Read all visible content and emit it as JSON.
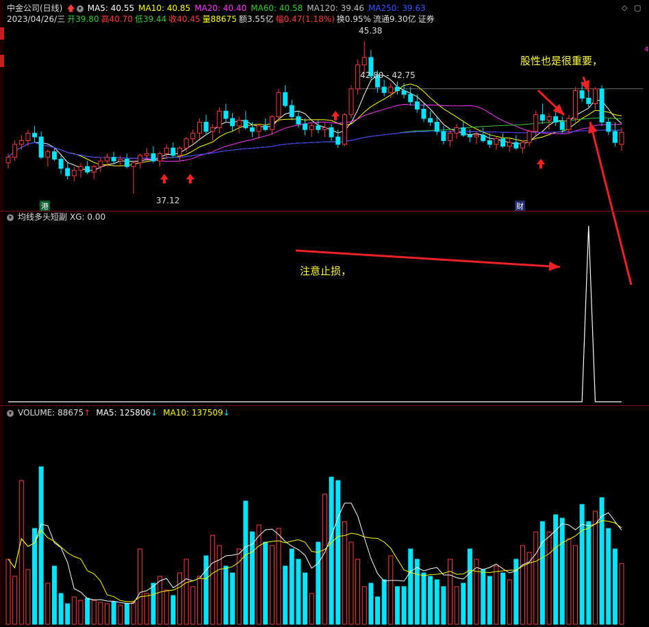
{
  "header": {
    "stock_name": "中金公司(日线)",
    "ma5": "MA5: 40.55",
    "ma10": "MA10: 40.85",
    "ma20": "MA20: 40.40",
    "ma60": "MA60: 40.58",
    "ma120": "MA120: 39.46",
    "ma250": "MA250: 39.63",
    "date": "2023/04/26/三",
    "open": "开39.80",
    "high": "高40.70",
    "low": "低39.44",
    "close": "收40.45",
    "volume": "量88675",
    "amount": "额3.55亿",
    "change": "幅0.47(1.18%)",
    "turnover": "换0.95%",
    "float_cap": "流通9.30亿",
    "sector": "证券"
  },
  "price_labels": {
    "high_mark": "45.38",
    "low_mark": "37.12",
    "range_mark": "42.80 - 42.75",
    "right_edge": "4"
  },
  "badges": {
    "left_badge": "港",
    "right_badge": "财"
  },
  "annotations": {
    "a1": "股性也是很重要，",
    "a2": "注意止损，"
  },
  "indicator_panel": {
    "title": "均线多头短副",
    "value": "XG: 0.00"
  },
  "volume_panel": {
    "volume": "VOLUME: 88675",
    "ma5": "MA5: 125806",
    "ma10": "MA10: 137509"
  },
  "colors": {
    "up": "#ff3c3c",
    "down": "#00e5ff",
    "ma5": "#ffffff",
    "ma10": "#ffff00",
    "ma20": "#ff33ff",
    "ma60": "#33cc33",
    "ma120": "#aaaaaa",
    "ma250": "#3333ff",
    "arrow": "#ee2222"
  },
  "chart_data": {
    "type": "candlestick",
    "price_axis_range": [
      36.5,
      46.2
    ],
    "candles": [
      [
        38.8,
        39.3,
        38.5,
        39.1
      ],
      [
        39.1,
        40.0,
        38.9,
        39.8
      ],
      [
        39.8,
        40.3,
        39.5,
        40.0
      ],
      [
        40.0,
        40.6,
        39.7,
        40.4
      ],
      [
        40.4,
        40.8,
        39.9,
        40.2
      ],
      [
        40.2,
        40.5,
        39.0,
        39.1
      ],
      [
        39.1,
        39.5,
        38.6,
        39.4
      ],
      [
        39.4,
        39.6,
        38.9,
        39.0
      ],
      [
        39.0,
        39.2,
        38.2,
        38.5
      ],
      [
        38.5,
        38.8,
        37.9,
        38.1
      ],
      [
        38.1,
        38.6,
        37.8,
        38.4
      ],
      [
        38.4,
        38.8,
        38.0,
        38.6
      ],
      [
        38.6,
        38.9,
        38.2,
        38.3
      ],
      [
        38.3,
        38.7,
        37.9,
        38.6
      ],
      [
        38.6,
        39.1,
        38.3,
        38.9
      ],
      [
        38.9,
        39.3,
        38.6,
        39.1
      ],
      [
        39.1,
        39.4,
        38.7,
        38.9
      ],
      [
        38.9,
        39.2,
        38.6,
        39.0
      ],
      [
        39.0,
        39.3,
        38.5,
        38.6
      ],
      [
        38.6,
        38.9,
        37.12,
        38.8
      ],
      [
        38.8,
        39.3,
        38.5,
        39.2
      ],
      [
        39.2,
        39.6,
        38.9,
        39.3
      ],
      [
        39.3,
        39.7,
        38.8,
        38.9
      ],
      [
        38.9,
        39.4,
        38.6,
        39.3
      ],
      [
        39.3,
        39.8,
        39.0,
        39.6
      ],
      [
        39.6,
        39.9,
        39.1,
        39.2
      ],
      [
        39.2,
        39.7,
        38.9,
        39.6
      ],
      [
        39.6,
        40.2,
        39.4,
        40.1
      ],
      [
        40.1,
        40.6,
        39.8,
        40.4
      ],
      [
        40.4,
        41.2,
        40.1,
        41.0
      ],
      [
        41.0,
        41.4,
        40.3,
        40.5
      ],
      [
        40.5,
        40.9,
        40.0,
        40.7
      ],
      [
        40.7,
        41.8,
        40.4,
        41.6
      ],
      [
        41.6,
        42.0,
        41.0,
        41.2
      ],
      [
        41.2,
        41.5,
        40.5,
        40.8
      ],
      [
        40.8,
        41.3,
        40.4,
        41.1
      ],
      [
        41.1,
        41.6,
        40.6,
        40.7
      ],
      [
        40.7,
        41.0,
        40.2,
        40.5
      ],
      [
        40.5,
        40.9,
        40.1,
        40.8
      ],
      [
        40.8,
        41.2,
        40.5,
        40.6
      ],
      [
        40.6,
        41.4,
        40.3,
        41.3
      ],
      [
        41.3,
        42.8,
        41.0,
        42.6
      ],
      [
        42.6,
        43.0,
        41.8,
        41.9
      ],
      [
        41.9,
        42.2,
        41.1,
        41.3
      ],
      [
        41.3,
        41.6,
        40.7,
        40.9
      ],
      [
        40.9,
        41.2,
        40.3,
        40.6
      ],
      [
        40.6,
        41.0,
        40.2,
        40.8
      ],
      [
        40.8,
        41.1,
        40.4,
        40.6
      ],
      [
        40.6,
        41.0,
        40.2,
        40.7
      ],
      [
        40.7,
        40.9,
        40.0,
        40.2
      ],
      [
        40.2,
        40.6,
        39.6,
        39.8
      ],
      [
        39.8,
        41.5,
        39.7,
        41.4
      ],
      [
        41.4,
        43.0,
        41.2,
        42.8
      ],
      [
        42.8,
        44.4,
        42.5,
        44.1
      ],
      [
        44.1,
        45.38,
        43.6,
        44.5
      ],
      [
        44.5,
        44.9,
        43.3,
        43.5
      ],
      [
        43.5,
        43.8,
        42.6,
        42.9
      ],
      [
        42.9,
        43.3,
        42.4,
        42.6
      ],
      [
        42.6,
        43.1,
        42.3,
        42.9
      ],
      [
        42.9,
        43.2,
        42.5,
        42.7
      ],
      [
        42.7,
        43.1,
        42.3,
        42.5
      ],
      [
        42.5,
        42.9,
        41.9,
        42.1
      ],
      [
        42.1,
        42.5,
        41.5,
        41.7
      ],
      [
        41.7,
        42.0,
        41.0,
        41.2
      ],
      [
        41.2,
        41.6,
        40.8,
        41.0
      ],
      [
        41.0,
        41.3,
        40.3,
        40.5
      ],
      [
        40.5,
        40.8,
        39.8,
        40.0
      ],
      [
        40.0,
        40.6,
        39.7,
        40.4
      ],
      [
        40.4,
        40.9,
        40.1,
        40.7
      ],
      [
        40.7,
        41.1,
        40.2,
        40.3
      ],
      [
        40.3,
        40.6,
        39.9,
        40.2
      ],
      [
        40.2,
        40.5,
        39.8,
        40.3
      ],
      [
        40.3,
        40.7,
        39.9,
        40.0
      ],
      [
        40.0,
        40.4,
        39.6,
        39.8
      ],
      [
        39.8,
        40.2,
        39.5,
        40.1
      ],
      [
        40.1,
        40.4,
        39.6,
        39.7
      ],
      [
        39.7,
        40.1,
        39.4,
        39.9
      ],
      [
        39.9,
        40.3,
        39.5,
        39.6
      ],
      [
        39.6,
        40.0,
        39.3,
        39.9
      ],
      [
        39.9,
        40.6,
        39.7,
        40.5
      ],
      [
        40.5,
        41.6,
        40.3,
        41.4
      ],
      [
        41.4,
        42.0,
        40.9,
        41.1
      ],
      [
        41.1,
        41.5,
        40.6,
        41.3
      ],
      [
        41.3,
        41.8,
        40.8,
        41.0
      ],
      [
        41.0,
        41.3,
        40.4,
        40.6
      ],
      [
        40.6,
        41.4,
        40.4,
        41.2
      ],
      [
        41.2,
        42.9,
        41.0,
        42.7
      ],
      [
        42.7,
        43.2,
        42.1,
        42.3
      ],
      [
        42.3,
        42.7,
        41.8,
        42.0
      ],
      [
        42.0,
        42.9,
        41.7,
        42.8
      ],
      [
        42.8,
        43.0,
        40.8,
        41.0
      ],
      [
        41.0,
        41.2,
        40.3,
        40.5
      ],
      [
        40.5,
        41.0,
        39.7,
        39.9
      ],
      [
        39.8,
        40.7,
        39.44,
        40.45
      ]
    ],
    "volume_axis_max": 300000,
    "volumes": [
      95000,
      70000,
      210000,
      80000,
      140000,
      230000,
      60000,
      85000,
      45000,
      30000,
      40000,
      35000,
      38000,
      35000,
      32000,
      30000,
      33000,
      28000,
      30000,
      32000,
      110000,
      45000,
      60000,
      70000,
      50000,
      42000,
      75000,
      95000,
      55000,
      70000,
      100000,
      130000,
      115000,
      85000,
      75000,
      110000,
      180000,
      135000,
      145000,
      120000,
      115000,
      140000,
      85000,
      110000,
      95000,
      75000,
      45000,
      120000,
      190000,
      215000,
      210000,
      150000,
      120000,
      95000,
      55000,
      60000,
      40000,
      65000,
      100000,
      55000,
      55000,
      110000,
      95000,
      75000,
      70000,
      65000,
      55000,
      95000,
      55000,
      60000,
      110000,
      95000,
      80000,
      70000,
      85000,
      75000,
      65000,
      95000,
      115000,
      105000,
      135000,
      150000,
      135000,
      160000,
      155000,
      125000,
      115000,
      175000,
      150000,
      165000,
      185000,
      140000,
      110000,
      88675
    ],
    "xg_series": "0 everywhere except spike to 1 near bar 88",
    "xg_axis_range": [
      0,
      1.02
    ],
    "xg_spike_index": 88
  }
}
